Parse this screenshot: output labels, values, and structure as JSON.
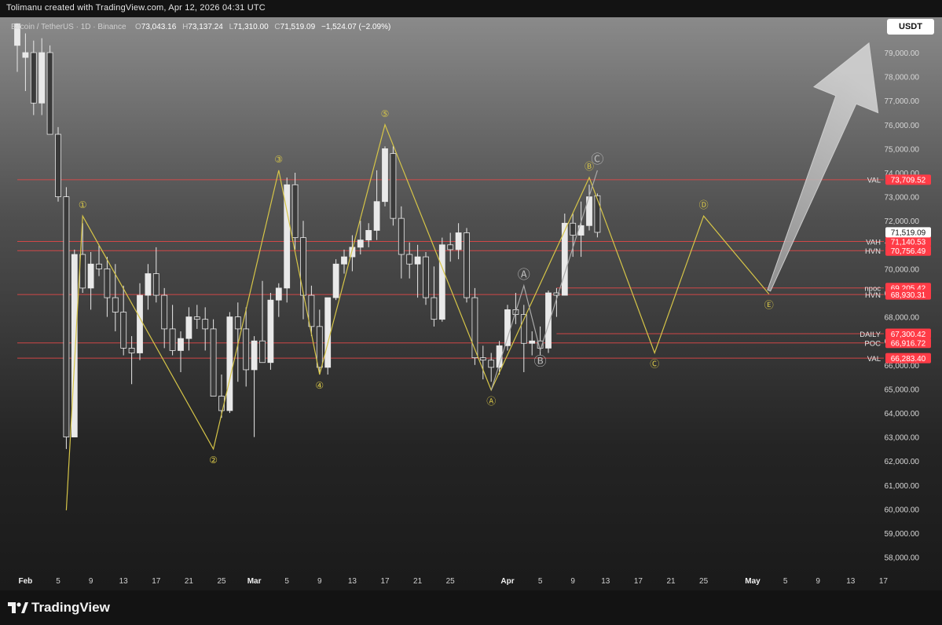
{
  "header": {
    "credit": "Tolimanu created with TradingView.com, Apr 12, 2026 04:31 UTC"
  },
  "symbol": {
    "name": "Bitcoin / TetherUS · 1D · Binance",
    "o_label": "O",
    "o": "73,043.16",
    "h_label": "H",
    "h": "73,137.24",
    "l_label": "L",
    "l": "71,310.00",
    "c_label": "C",
    "c": "71,519.09",
    "change": "−1,524.07 (−2.09%)"
  },
  "currency_button": "USDT",
  "brand": {
    "name": "TradingView"
  },
  "colors": {
    "candle": "#e9e9e9",
    "level": "#e04848",
    "wave": "#d6c548",
    "corrective": "#a9a9a9",
    "price_label_bg": "#ff3b46"
  },
  "chart_data": {
    "type": "candlestick",
    "timeframe": "1D",
    "ylim": [
      57000,
      80300
    ],
    "y_ticks": [
      58000,
      59000,
      60000,
      61000,
      62000,
      63000,
      64000,
      65000,
      66000,
      67000,
      68000,
      69000,
      70000,
      71000,
      72000,
      73000,
      74000,
      75000,
      76000,
      77000,
      78000,
      79000
    ],
    "y_tick_labels": [
      "58,000.00",
      "59,000.00",
      "60,000.00",
      "61,000.00",
      "62,000.00",
      "63,000.00",
      "64,000.00",
      "65,000.00",
      "66,000.00",
      "67,000.00",
      "68,000.00",
      "69,000.00",
      "70,000.00",
      "71,000.00",
      "72,000.00",
      "73,000.00",
      "74,000.00",
      "75,000.00",
      "76,000.00",
      "77,000.00",
      "78,000.00",
      "79,000.00"
    ],
    "x_range": [
      "2026-01-31",
      "2026-05-17"
    ],
    "x_ticks": [
      {
        "date": "2026-02-01",
        "label": "Feb",
        "major": true
      },
      {
        "date": "2026-02-05",
        "label": "5"
      },
      {
        "date": "2026-02-09",
        "label": "9"
      },
      {
        "date": "2026-02-13",
        "label": "13"
      },
      {
        "date": "2026-02-17",
        "label": "17"
      },
      {
        "date": "2026-02-21",
        "label": "21"
      },
      {
        "date": "2026-02-25",
        "label": "25"
      },
      {
        "date": "2026-03-01",
        "label": "Mar",
        "major": true
      },
      {
        "date": "2026-03-05",
        "label": "5"
      },
      {
        "date": "2026-03-09",
        "label": "9"
      },
      {
        "date": "2026-03-13",
        "label": "13"
      },
      {
        "date": "2026-03-17",
        "label": "17"
      },
      {
        "date": "2026-03-21",
        "label": "21"
      },
      {
        "date": "2026-03-25",
        "label": "25"
      },
      {
        "date": "2026-04-01",
        "label": "Apr",
        "major": true
      },
      {
        "date": "2026-04-05",
        "label": "5"
      },
      {
        "date": "2026-04-09",
        "label": "9"
      },
      {
        "date": "2026-04-13",
        "label": "13"
      },
      {
        "date": "2026-04-17",
        "label": "17"
      },
      {
        "date": "2026-04-21",
        "label": "21"
      },
      {
        "date": "2026-04-25",
        "label": "25"
      },
      {
        "date": "2026-05-01",
        "label": "May",
        "major": true
      },
      {
        "date": "2026-05-05",
        "label": "5"
      },
      {
        "date": "2026-05-09",
        "label": "9"
      },
      {
        "date": "2026-05-13",
        "label": "13"
      },
      {
        "date": "2026-05-17",
        "label": "17"
      }
    ],
    "candles": [
      {
        "date": "2026-01-31",
        "o": 79300,
        "h": 80200,
        "l": 78200,
        "c": 80200
      },
      {
        "date": "2026-02-01",
        "o": 78800,
        "h": 79800,
        "l": 77400,
        "c": 79000
      },
      {
        "date": "2026-02-02",
        "o": 79000,
        "h": 79500,
        "l": 76400,
        "c": 76900
      },
      {
        "date": "2026-02-03",
        "o": 76900,
        "h": 79600,
        "l": 76400,
        "c": 79000
      },
      {
        "date": "2026-02-04",
        "o": 79000,
        "h": 79300,
        "l": 75600,
        "c": 75600
      },
      {
        "date": "2026-02-05",
        "o": 75600,
        "h": 75900,
        "l": 72800,
        "c": 73000
      },
      {
        "date": "2026-02-06",
        "o": 73000,
        "h": 73400,
        "l": 62500,
        "c": 63000
      },
      {
        "date": "2026-02-07",
        "o": 63000,
        "h": 70800,
        "l": 63000,
        "c": 70600
      },
      {
        "date": "2026-02-08",
        "o": 70600,
        "h": 71900,
        "l": 69000,
        "c": 69200
      },
      {
        "date": "2026-02-09",
        "o": 69200,
        "h": 70700,
        "l": 68300,
        "c": 70200
      },
      {
        "date": "2026-02-10",
        "o": 70200,
        "h": 71000,
        "l": 69700,
        "c": 70000
      },
      {
        "date": "2026-02-11",
        "o": 70000,
        "h": 70500,
        "l": 68000,
        "c": 68800
      },
      {
        "date": "2026-02-12",
        "o": 68800,
        "h": 70200,
        "l": 67400,
        "c": 68200
      },
      {
        "date": "2026-02-13",
        "o": 68200,
        "h": 69300,
        "l": 66400,
        "c": 66700
      },
      {
        "date": "2026-02-14",
        "o": 66700,
        "h": 67200,
        "l": 65200,
        "c": 66500
      },
      {
        "date": "2026-02-15",
        "o": 66500,
        "h": 69400,
        "l": 66200,
        "c": 68900
      },
      {
        "date": "2026-02-16",
        "o": 68900,
        "h": 70200,
        "l": 68300,
        "c": 69800
      },
      {
        "date": "2026-02-17",
        "o": 69800,
        "h": 70900,
        "l": 68600,
        "c": 68900
      },
      {
        "date": "2026-02-18",
        "o": 68900,
        "h": 69200,
        "l": 66700,
        "c": 67500
      },
      {
        "date": "2026-02-19",
        "o": 67500,
        "h": 68500,
        "l": 66400,
        "c": 66600
      },
      {
        "date": "2026-02-20",
        "o": 66600,
        "h": 67400,
        "l": 65700,
        "c": 67100
      },
      {
        "date": "2026-02-21",
        "o": 67100,
        "h": 68400,
        "l": 66600,
        "c": 68000
      },
      {
        "date": "2026-02-22",
        "o": 68000,
        "h": 68500,
        "l": 67500,
        "c": 67900
      },
      {
        "date": "2026-02-23",
        "o": 67900,
        "h": 68400,
        "l": 66600,
        "c": 67500
      },
      {
        "date": "2026-02-24",
        "o": 67500,
        "h": 67900,
        "l": 64700,
        "c": 64700
      },
      {
        "date": "2026-02-25",
        "o": 64700,
        "h": 65600,
        "l": 63800,
        "c": 64100
      },
      {
        "date": "2026-02-26",
        "o": 64100,
        "h": 68200,
        "l": 64000,
        "c": 68000
      },
      {
        "date": "2026-02-27",
        "o": 68000,
        "h": 68600,
        "l": 65300,
        "c": 67500
      },
      {
        "date": "2026-02-28",
        "o": 67500,
        "h": 68400,
        "l": 65100,
        "c": 65800
      },
      {
        "date": "2026-03-01",
        "o": 65800,
        "h": 67200,
        "l": 63000,
        "c": 67000
      },
      {
        "date": "2026-03-02",
        "o": 67000,
        "h": 69500,
        "l": 66400,
        "c": 66100
      },
      {
        "date": "2026-03-03",
        "o": 66100,
        "h": 69000,
        "l": 65800,
        "c": 68700
      },
      {
        "date": "2026-03-04",
        "o": 68700,
        "h": 69400,
        "l": 68000,
        "c": 69200
      },
      {
        "date": "2026-03-05",
        "o": 69200,
        "h": 73800,
        "l": 68600,
        "c": 73500
      },
      {
        "date": "2026-03-06",
        "o": 73500,
        "h": 74000,
        "l": 70800,
        "c": 71300
      },
      {
        "date": "2026-03-07",
        "o": 71300,
        "h": 72000,
        "l": 67900,
        "c": 68900
      },
      {
        "date": "2026-03-08",
        "o": 68900,
        "h": 69300,
        "l": 67200,
        "c": 67600
      },
      {
        "date": "2026-03-09",
        "o": 67600,
        "h": 68300,
        "l": 65600,
        "c": 65900
      },
      {
        "date": "2026-03-10",
        "o": 65900,
        "h": 68800,
        "l": 65600,
        "c": 68800
      },
      {
        "date": "2026-03-11",
        "o": 68800,
        "h": 70400,
        "l": 68700,
        "c": 70200
      },
      {
        "date": "2026-03-12",
        "o": 70200,
        "h": 70800,
        "l": 69800,
        "c": 70500
      },
      {
        "date": "2026-03-13",
        "o": 70500,
        "h": 71400,
        "l": 69900,
        "c": 70900
      },
      {
        "date": "2026-03-14",
        "o": 70900,
        "h": 72000,
        "l": 70600,
        "c": 71200
      },
      {
        "date": "2026-03-15",
        "o": 71200,
        "h": 71900,
        "l": 70900,
        "c": 71600
      },
      {
        "date": "2026-03-16",
        "o": 71600,
        "h": 74100,
        "l": 71200,
        "c": 72800
      },
      {
        "date": "2026-03-17",
        "o": 72800,
        "h": 75100,
        "l": 72600,
        "c": 75000
      },
      {
        "date": "2026-03-18",
        "o": 74800,
        "h": 75100,
        "l": 71800,
        "c": 72100
      },
      {
        "date": "2026-03-19",
        "o": 72100,
        "h": 72600,
        "l": 69600,
        "c": 70600
      },
      {
        "date": "2026-03-20",
        "o": 70600,
        "h": 71100,
        "l": 69600,
        "c": 70200
      },
      {
        "date": "2026-03-21",
        "o": 70200,
        "h": 71000,
        "l": 68800,
        "c": 70500
      },
      {
        "date": "2026-03-22",
        "o": 70500,
        "h": 70700,
        "l": 68500,
        "c": 68800
      },
      {
        "date": "2026-03-23",
        "o": 68800,
        "h": 70100,
        "l": 67600,
        "c": 67900
      },
      {
        "date": "2026-03-24",
        "o": 67900,
        "h": 71300,
        "l": 67800,
        "c": 71000
      },
      {
        "date": "2026-03-25",
        "o": 71000,
        "h": 71500,
        "l": 70300,
        "c": 70800
      },
      {
        "date": "2026-03-26",
        "o": 70800,
        "h": 71900,
        "l": 70400,
        "c": 71500
      },
      {
        "date": "2026-03-27",
        "o": 71500,
        "h": 71700,
        "l": 68600,
        "c": 68800
      },
      {
        "date": "2026-03-28",
        "o": 68800,
        "h": 69200,
        "l": 66000,
        "c": 66300
      },
      {
        "date": "2026-03-29",
        "o": 66300,
        "h": 66800,
        "l": 65400,
        "c": 66200
      },
      {
        "date": "2026-03-30",
        "o": 66200,
        "h": 66500,
        "l": 65300,
        "c": 65900
      },
      {
        "date": "2026-03-31",
        "o": 65900,
        "h": 67000,
        "l": 65600,
        "c": 66800
      },
      {
        "date": "2026-04-01",
        "o": 66800,
        "h": 68500,
        "l": 66600,
        "c": 68300
      },
      {
        "date": "2026-04-02",
        "o": 68300,
        "h": 69000,
        "l": 67700,
        "c": 68100
      },
      {
        "date": "2026-04-03",
        "o": 68100,
        "h": 68500,
        "l": 65700,
        "c": 66900
      },
      {
        "date": "2026-04-04",
        "o": 66900,
        "h": 67400,
        "l": 66400,
        "c": 67000
      },
      {
        "date": "2026-04-05",
        "o": 67000,
        "h": 67600,
        "l": 66400,
        "c": 66700
      },
      {
        "date": "2026-04-06",
        "o": 66700,
        "h": 69100,
        "l": 66500,
        "c": 69000
      },
      {
        "date": "2026-04-07",
        "o": 69000,
        "h": 69200,
        "l": 68000,
        "c": 68900
      },
      {
        "date": "2026-04-08",
        "o": 68900,
        "h": 72300,
        "l": 68900,
        "c": 71900
      },
      {
        "date": "2026-04-09",
        "o": 71900,
        "h": 72300,
        "l": 70500,
        "c": 71400
      },
      {
        "date": "2026-04-10",
        "o": 71400,
        "h": 72800,
        "l": 70500,
        "c": 71800
      },
      {
        "date": "2026-04-11",
        "o": 71800,
        "h": 73500,
        "l": 71600,
        "c": 73000
      },
      {
        "date": "2026-04-12",
        "o": 73043,
        "h": 73137,
        "l": 71310,
        "c": 71519
      }
    ],
    "price_levels": [
      {
        "price": 73709.52,
        "label": "73,709.52",
        "tag": "VAL",
        "line_start": "2026-01-31"
      },
      {
        "price": 71140.53,
        "label": "71,140.53",
        "tag": "VAH",
        "line_start": "2026-01-31"
      },
      {
        "price": 70756.49,
        "label": "70,756.49",
        "tag": "HVN",
        "line_start": "2026-01-31"
      },
      {
        "price": 69205.42,
        "label": "69,205.42",
        "tag": "npoc",
        "line_start": "2026-04-07"
      },
      {
        "price": 68930.31,
        "label": "68,930.31",
        "tag": "HVN",
        "line_start": "2026-01-31"
      },
      {
        "price": 67300.42,
        "label": "67,300.42",
        "tag": "DAILY",
        "line_start": "2026-04-07"
      },
      {
        "price": 66916.72,
        "label": "66,916.72",
        "tag": "POC",
        "line_start": "2026-01-31"
      },
      {
        "price": 66283.4,
        "label": "66,283.40",
        "tag": "VAL",
        "line_start": "2026-01-31"
      }
    ],
    "last_price": {
      "value": 71519.09,
      "label": "71,519.09"
    },
    "impulse_wave": [
      {
        "date": "2026-02-06",
        "price": 59950,
        "label": ""
      },
      {
        "date": "2026-02-08",
        "price": 72200,
        "label": "①",
        "label_pos": "above"
      },
      {
        "date": "2026-02-24",
        "price": 62500,
        "label": "②",
        "label_pos": "below"
      },
      {
        "date": "2026-03-04",
        "price": 74100,
        "label": "③",
        "label_pos": "above"
      },
      {
        "date": "2026-03-09",
        "price": 65600,
        "label": "④",
        "label_pos": "below"
      },
      {
        "date": "2026-03-17",
        "price": 76000,
        "label": "⑤",
        "label_pos": "above"
      },
      {
        "date": "2026-03-30",
        "price": 64950,
        "label": "Ⓐ",
        "label_pos": "below"
      },
      {
        "date": "2026-04-11",
        "price": 73800,
        "label": "Ⓑ",
        "label_pos": "above"
      },
      {
        "date": "2026-04-19",
        "price": 66500,
        "label": "Ⓒ",
        "label_pos": "below"
      },
      {
        "date": "2026-04-25",
        "price": 72200,
        "label": "Ⓓ",
        "label_pos": "above"
      },
      {
        "date": "2026-05-03",
        "price": 68950,
        "label": "Ⓔ",
        "label_pos": "below"
      }
    ],
    "corrective_wave": [
      {
        "date": "2026-03-30",
        "price": 64950,
        "label": ""
      },
      {
        "date": "2026-04-03",
        "price": 69300,
        "label": "Ⓐ",
        "label_pos": "above"
      },
      {
        "date": "2026-04-05",
        "price": 66600,
        "label": "Ⓑ",
        "label_pos": "below"
      },
      {
        "date": "2026-04-12",
        "price": 74100,
        "label": "Ⓒ",
        "label_pos": "above"
      }
    ],
    "projection_arrow": {
      "from": {
        "date": "2026-05-03",
        "price": 69100
      },
      "to": {
        "date": "2026-05-06",
        "price": 79400
      },
      "direction": "up"
    }
  }
}
